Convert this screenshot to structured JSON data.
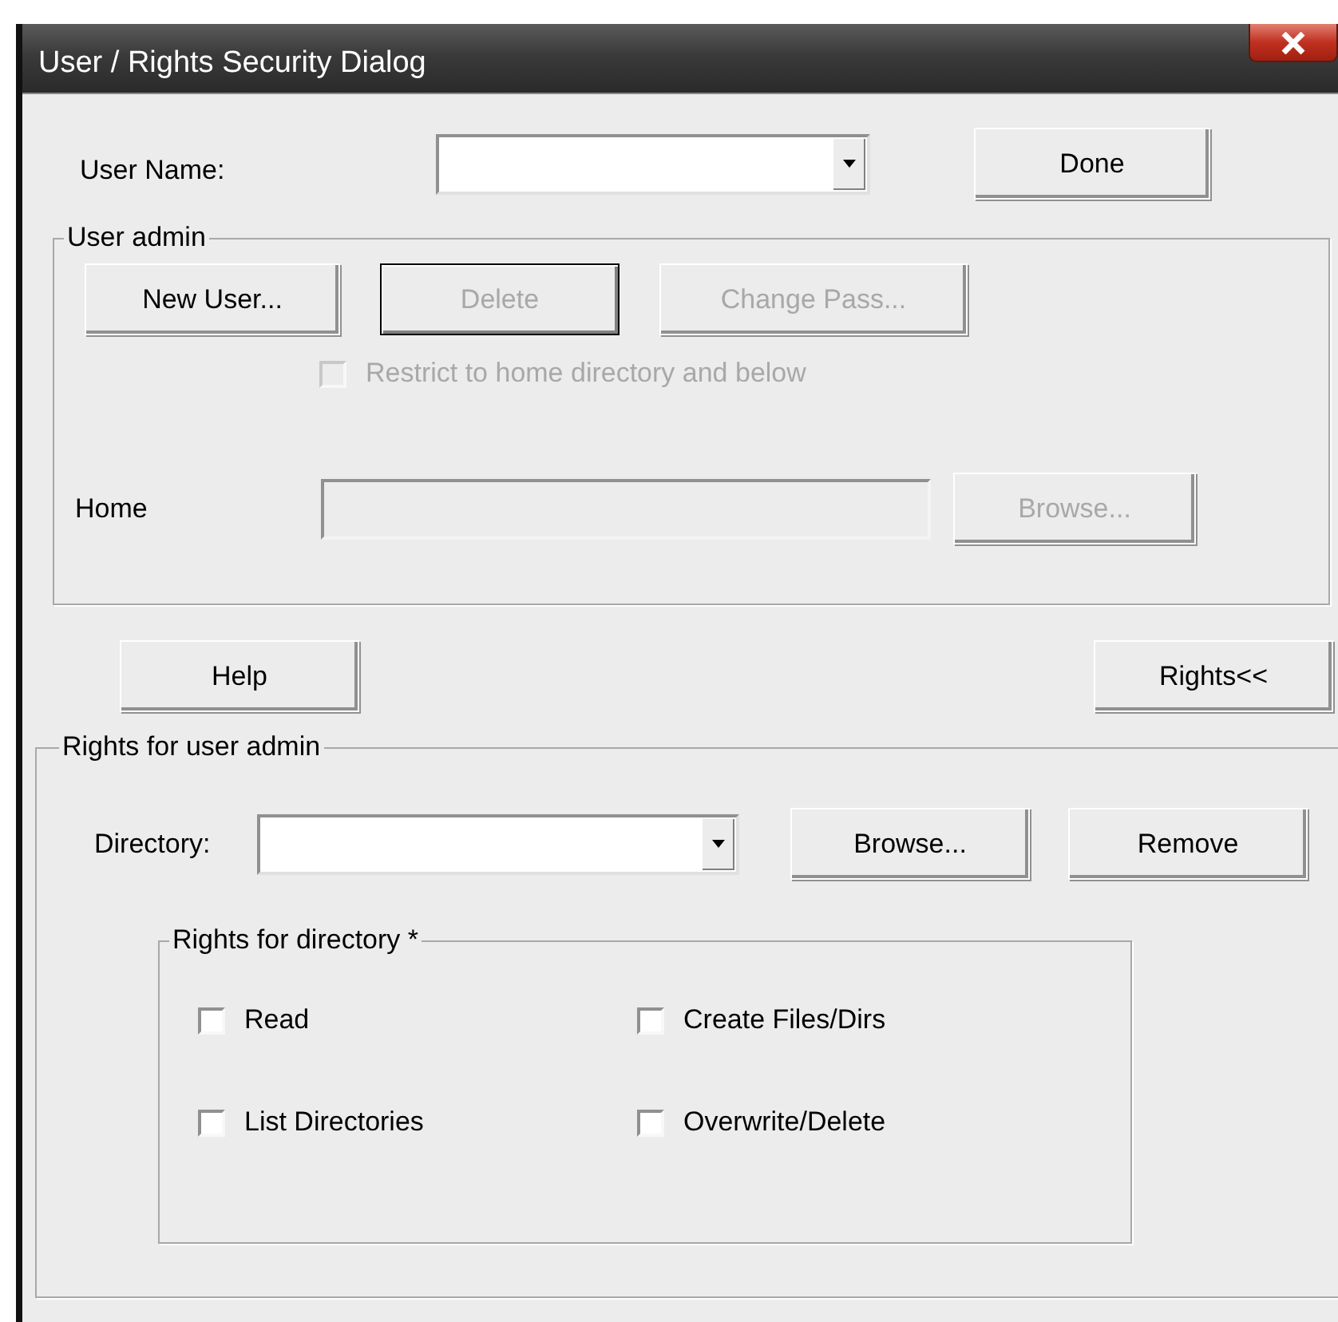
{
  "window": {
    "title": "User / Rights Security Dialog"
  },
  "user_name": {
    "label": "User Name:",
    "done_button": "Done"
  },
  "user_admin": {
    "title": "User admin",
    "buttons": [
      {
        "label": "New User...",
        "disabled": false,
        "focused": false
      },
      {
        "label": "Delete",
        "disabled": true,
        "focused": true
      },
      {
        "label": "Change Pass...",
        "disabled": true,
        "focused": false
      }
    ],
    "restrict": {
      "label": "Restrict to home directory and below",
      "checked": false,
      "disabled": true
    },
    "home": {
      "label": "Home",
      "disabled": true,
      "browse_button": {
        "label": "Browse...",
        "disabled": true,
        "focused": false
      }
    }
  },
  "help_button": "Help",
  "rights_toggle_button": "Rights<<",
  "rights": {
    "title": "Rights for user admin",
    "directory_label": "Directory:",
    "buttons": [
      {
        "label": "Browse...",
        "disabled": false,
        "focused": false
      },
      {
        "label": "Remove",
        "disabled": false,
        "focused": false
      }
    ],
    "directory_rights": {
      "title": "Rights for directory *",
      "options": [
        {
          "label": "Read",
          "checked": false
        },
        {
          "label": "Create Files/Dirs",
          "checked": false
        },
        {
          "label": "List Directories",
          "checked": false
        },
        {
          "label": "Overwrite/Delete",
          "checked": false
        }
      ]
    }
  }
}
